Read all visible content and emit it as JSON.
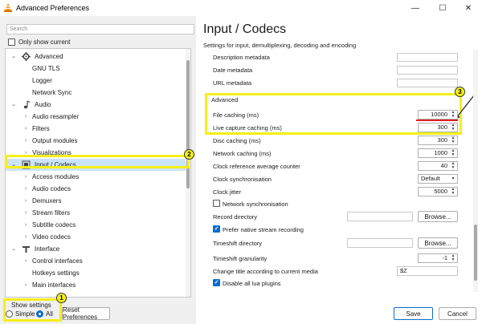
{
  "window": {
    "title": "Advanced Preferences",
    "min": "—",
    "max": "☐",
    "close": "✕"
  },
  "left": {
    "search_placeholder": "Search",
    "only_show_current": "Only show current",
    "tree": [
      {
        "label": "Advanced",
        "level": 0,
        "expanded": true,
        "icon": "gear-icon"
      },
      {
        "label": "GNU TLS",
        "level": 1
      },
      {
        "label": "Logger",
        "level": 1
      },
      {
        "label": "Network Sync",
        "level": 1
      },
      {
        "label": "Audio",
        "level": 0,
        "expanded": true,
        "icon": "music-note-icon"
      },
      {
        "label": "Audio resampler",
        "level": 1,
        "expandable": true
      },
      {
        "label": "Filters",
        "level": 1,
        "expandable": true
      },
      {
        "label": "Output modules",
        "level": 1,
        "expandable": true
      },
      {
        "label": "Visualizations",
        "level": 1,
        "expandable": true
      },
      {
        "label": "Input / Codecs",
        "level": 0,
        "expanded": true,
        "selected": true,
        "icon": "codec-icon"
      },
      {
        "label": "Access modules",
        "level": 1,
        "expandable": true
      },
      {
        "label": "Audio codecs",
        "level": 1,
        "expandable": true
      },
      {
        "label": "Demuxers",
        "level": 1,
        "expandable": true
      },
      {
        "label": "Stream filters",
        "level": 1,
        "expandable": true
      },
      {
        "label": "Subtitle codecs",
        "level": 1,
        "expandable": true
      },
      {
        "label": "Video codecs",
        "level": 1,
        "expandable": true
      },
      {
        "label": "Interface",
        "level": 0,
        "expanded": true,
        "icon": "interface-icon"
      },
      {
        "label": "Control interfaces",
        "level": 1,
        "expandable": true
      },
      {
        "label": "Hotkeys settings",
        "level": 1
      },
      {
        "label": "Main interfaces",
        "level": 1,
        "expandable": true
      }
    ],
    "show_settings_label": "Show settings",
    "simple_label": "Simple",
    "all_label": "All",
    "reset_label": "Reset Preferences"
  },
  "right": {
    "title": "Input / Codecs",
    "subtitle": "Settings for input, demultiplexing, decoding and encoding",
    "rows": {
      "description_metadata": "Description metadata",
      "date_metadata": "Date metadata",
      "url_metadata": "URL metadata",
      "advanced_header": "Advanced",
      "file_caching": {
        "label": "File caching (ms)",
        "value": "10000"
      },
      "live_capture_caching": {
        "label": "Live capture caching (ms)",
        "value": "300"
      },
      "disc_caching": {
        "label": "Disc caching (ms)",
        "value": "300"
      },
      "network_caching": {
        "label": "Network caching (ms)",
        "value": "1000"
      },
      "clock_reference": {
        "label": "Clock reference average counter",
        "value": "40"
      },
      "clock_sync": {
        "label": "Clock synchronisation",
        "value": "Default"
      },
      "clock_jitter": {
        "label": "Clock jitter",
        "value": "5000"
      },
      "network_sync": {
        "label": "Network synchronisation",
        "checked": false
      },
      "record_directory": {
        "label": "Record directory",
        "button": "Browse..."
      },
      "prefer_native": {
        "label": "Prefer native stream recording",
        "checked": true
      },
      "timeshift_directory": {
        "label": "Timeshift directory",
        "button": "Browse..."
      },
      "timeshift_granularity": {
        "label": "Timeshift granularity",
        "value": "-1"
      },
      "change_title": {
        "label": "Change title according to current media",
        "value": "$Z"
      },
      "disable_lua": {
        "label": "Disable all lua plugins",
        "checked": true
      }
    }
  },
  "footer": {
    "save": "Save",
    "cancel": "Cancel"
  },
  "callouts": [
    "1",
    "2",
    "3"
  ],
  "colors": {
    "highlight": "#f5ef1a",
    "selected_row": "#cce4f7",
    "accent": "#0a6cd0",
    "red_underline": "#e02020"
  }
}
